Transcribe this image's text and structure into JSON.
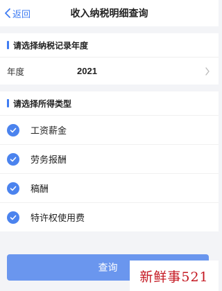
{
  "nav": {
    "back_label": "返回",
    "title": "收入纳税明细查询"
  },
  "year_section": {
    "heading": "请选择纳税记录年度",
    "row_label": "年度",
    "row_value": "2021"
  },
  "type_section": {
    "heading": "请选择所得类型",
    "options": [
      {
        "label": "工资薪金",
        "checked": true
      },
      {
        "label": "劳务报酬",
        "checked": true
      },
      {
        "label": "稿酬",
        "checked": true
      },
      {
        "label": "特许权使用费",
        "checked": true
      }
    ]
  },
  "query_button": "查询",
  "watermark": "新鲜事521",
  "colors": {
    "accent": "#3f7cf2",
    "check": "#4b83ee",
    "button": "#6a96ee",
    "watermark": "#c41822"
  },
  "icons": {
    "back": "chevron-left-icon",
    "select": "chevron-right-icon",
    "check": "check-circle-icon"
  }
}
